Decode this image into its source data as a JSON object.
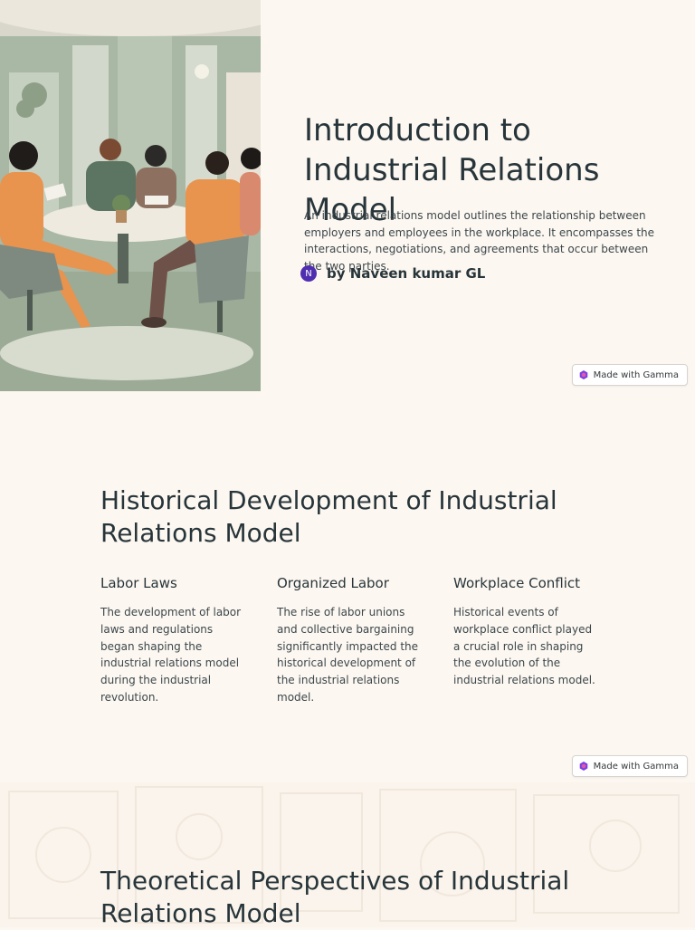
{
  "hero": {
    "image_alt": "Team meeting illustration",
    "title": "Introduction to Industrial Relations Model",
    "description": "An industrial relations model outlines the relationship between employers and employees in the workplace. It encompasses the interactions, negotiations, and agreements that occur between the two parties.",
    "author": {
      "avatar_letter": "N",
      "name": "by Naveen kumar GL"
    }
  },
  "badges": {
    "label": "Made with Gamma",
    "icon": "gamma-logo-icon",
    "accent": "#7b3fe4"
  },
  "history": {
    "title": "Historical Development of Industrial Relations Model",
    "columns": [
      {
        "title": "Labor Laws",
        "text": "The development of labor laws and regulations began shaping the industrial relations model during the industrial revolution."
      },
      {
        "title": "Organized Labor",
        "text": "The rise of labor unions and collective bargaining significantly impacted the historical development of the industrial relations model."
      },
      {
        "title": "Workplace Conflict",
        "text": "Historical events of workplace conflict played a crucial role in shaping the evolution of the industrial relations model."
      }
    ]
  },
  "theory": {
    "title": "Theoretical Perspectives of Industrial Relations Model"
  },
  "colors": {
    "background": "#fdf7f1",
    "heading": "#27353a",
    "avatar": "#4f2fb0"
  }
}
